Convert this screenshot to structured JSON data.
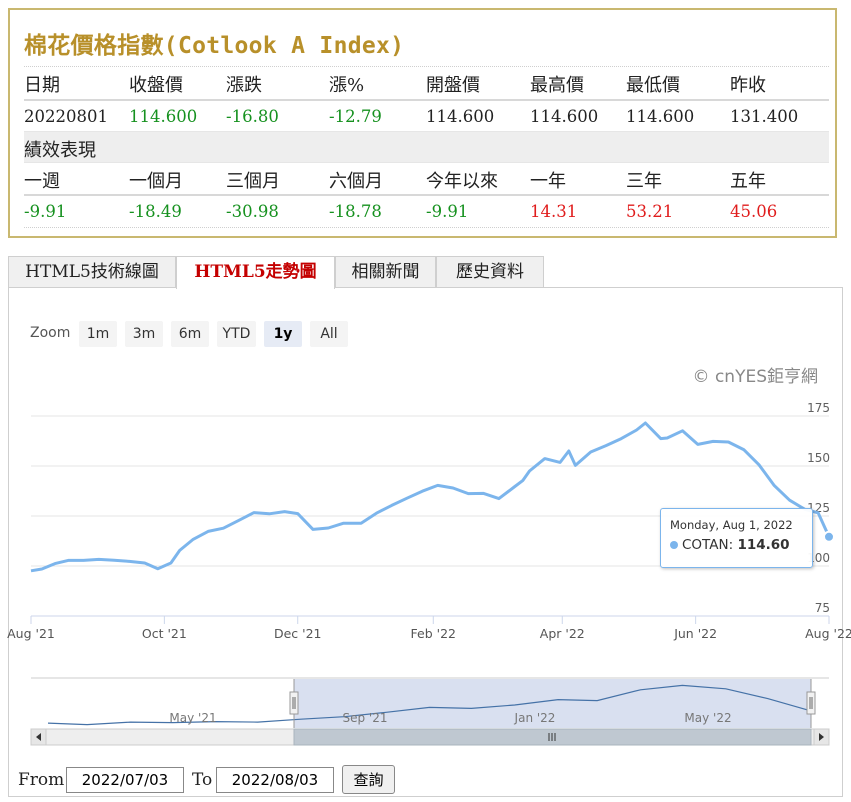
{
  "quote": {
    "title": "棉花價格指數(Cotlook A Index)",
    "headers": [
      "日期",
      "收盤價",
      "漲跌",
      "漲%",
      "開盤價",
      "最高價",
      "最低價",
      "昨收"
    ],
    "values": [
      {
        "text": "20220801",
        "color": "#222222"
      },
      {
        "text": "114.600",
        "color": "#16911f"
      },
      {
        "text": "-16.80",
        "color": "#16911f"
      },
      {
        "text": "-12.79",
        "color": "#16911f"
      },
      {
        "text": "114.600",
        "color": "#222222"
      },
      {
        "text": "114.600",
        "color": "#222222"
      },
      {
        "text": "114.600",
        "color": "#222222"
      },
      {
        "text": "131.400",
        "color": "#222222"
      }
    ],
    "perf_title": "績效表現",
    "perf_headers": [
      "一週",
      "一個月",
      "三個月",
      "六個月",
      "今年以來",
      "一年",
      "三年",
      "五年"
    ],
    "perf_values": [
      {
        "text": "-9.91",
        "color": "#16911f"
      },
      {
        "text": "-18.49",
        "color": "#16911f"
      },
      {
        "text": "-30.98",
        "color": "#16911f"
      },
      {
        "text": "-18.78",
        "color": "#16911f"
      },
      {
        "text": "-9.91",
        "color": "#16911f"
      },
      {
        "text": "14.31",
        "color": "#e01d1d"
      },
      {
        "text": "53.21",
        "color": "#e01d1d"
      },
      {
        "text": "45.06",
        "color": "#e01d1d"
      }
    ]
  },
  "tabs": [
    {
      "label": "HTML5技術線圖",
      "active": false
    },
    {
      "label": "HTML5走勢圖",
      "active": true
    },
    {
      "label": "相關新聞",
      "active": false
    },
    {
      "label": "歷史資料",
      "active": false
    }
  ],
  "zoom": {
    "label": "Zoom",
    "buttons": [
      {
        "label": "1m",
        "active": false
      },
      {
        "label": "3m",
        "active": false
      },
      {
        "label": "6m",
        "active": false
      },
      {
        "label": "YTD",
        "active": false
      },
      {
        "label": "1y",
        "active": true
      },
      {
        "label": "All",
        "active": false
      }
    ]
  },
  "credit": "© cnYES鉅亨網",
  "chart_data": {
    "type": "line",
    "series": [
      {
        "name": "COTAN"
      }
    ],
    "color": "#7cb5ec",
    "ylim": [
      75,
      175
    ],
    "yticks": [
      75,
      100,
      125,
      150,
      175
    ],
    "xticks": [
      {
        "label": "Aug '21",
        "date": "2021-08-01"
      },
      {
        "label": "Oct '21",
        "date": "2021-10-01"
      },
      {
        "label": "Dec '21",
        "date": "2021-12-01"
      },
      {
        "label": "Feb '22",
        "date": "2022-02-01"
      },
      {
        "label": "Apr '22",
        "date": "2022-04-01"
      },
      {
        "label": "Jun '22",
        "date": "2022-06-01"
      },
      {
        "label": "Aug '22",
        "date": "2022-08-01"
      }
    ],
    "x": [
      "2021-08-01",
      "2021-08-06",
      "2021-08-12",
      "2021-08-18",
      "2021-08-25",
      "2021-09-01",
      "2021-09-08",
      "2021-09-15",
      "2021-09-22",
      "2021-09-28",
      "2021-10-04",
      "2021-10-08",
      "2021-10-14",
      "2021-10-21",
      "2021-10-28",
      "2021-11-04",
      "2021-11-11",
      "2021-11-18",
      "2021-11-25",
      "2021-12-01",
      "2021-12-08",
      "2021-12-15",
      "2021-12-22",
      "2021-12-30",
      "2022-01-06",
      "2022-01-13",
      "2022-01-20",
      "2022-01-27",
      "2022-02-03",
      "2022-02-10",
      "2022-02-17",
      "2022-02-24",
      "2022-03-03",
      "2022-03-10",
      "2022-03-14",
      "2022-03-17",
      "2022-03-24",
      "2022-03-31",
      "2022-04-04",
      "2022-04-07",
      "2022-04-14",
      "2022-04-21",
      "2022-04-28",
      "2022-05-05",
      "2022-05-09",
      "2022-05-16",
      "2022-05-19",
      "2022-05-26",
      "2022-06-02",
      "2022-06-09",
      "2022-06-16",
      "2022-06-23",
      "2022-06-30",
      "2022-07-07",
      "2022-07-14",
      "2022-07-21",
      "2022-07-27",
      "2022-08-01"
    ],
    "y": [
      97.6,
      98.5,
      101.2,
      102.8,
      102.8,
      103.3,
      102.9,
      102.3,
      101.5,
      98.6,
      101.5,
      107.8,
      113.2,
      117.3,
      118.9,
      122.8,
      126.7,
      126.1,
      127.2,
      126.2,
      118.3,
      119.0,
      121.4,
      121.4,
      126.4,
      130.3,
      133.9,
      137.4,
      140.3,
      139.0,
      136.2,
      136.3,
      133.7,
      139.5,
      142.8,
      147.5,
      153.7,
      151.8,
      157.5,
      150.3,
      157.0,
      160.2,
      163.7,
      168.0,
      171.5,
      163.7,
      164.0,
      167.6,
      160.8,
      162.3,
      162.0,
      158.2,
      150.6,
      140.2,
      132.9,
      128.3,
      126.6,
      114.6
    ],
    "tooltip": {
      "date": "Monday, Aug 1, 2022",
      "series": "COTAN",
      "value": "114.60"
    },
    "navigator": {
      "labels": [
        "May '21",
        "Sep '21",
        "Jan '22",
        "May '22"
      ],
      "x": [
        "2021-02-01",
        "2021-03-01",
        "2021-04-01",
        "2021-05-01",
        "2021-06-01",
        "2021-07-01",
        "2021-08-01",
        "2021-09-01",
        "2021-10-01",
        "2021-11-01",
        "2021-12-01",
        "2022-01-01",
        "2022-02-01",
        "2022-03-01",
        "2022-04-01",
        "2022-05-01",
        "2022-06-01",
        "2022-07-01",
        "2022-08-01"
      ],
      "y": [
        90,
        87,
        92,
        91,
        93,
        92,
        98,
        103,
        112,
        122,
        120,
        127,
        138,
        136,
        158,
        167,
        160,
        140,
        115
      ]
    }
  },
  "range": {
    "from_label": "From",
    "from_value": "2022/07/03",
    "to_label": "To",
    "to_value": "2022/08/03",
    "query_label": "查詢"
  }
}
